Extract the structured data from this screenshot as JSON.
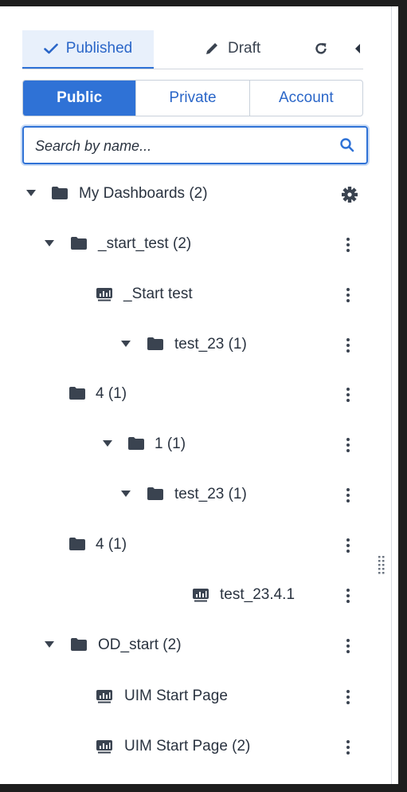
{
  "tabs": {
    "published_label": "Published",
    "draft_label": "Draft"
  },
  "segments": [
    "Public",
    "Private",
    "Account"
  ],
  "search": {
    "placeholder": "Search by name..."
  },
  "tree": {
    "root_label": "My Dashboards (2)",
    "items": [
      {
        "label": "_start_test (2)"
      },
      {
        "label": "_Start test"
      },
      {
        "label": "test_23 (1)"
      },
      {
        "label": "4 (1)"
      },
      {
        "label": "1 (1)"
      },
      {
        "label": "test_23 (1)"
      },
      {
        "label": "4 (1)"
      },
      {
        "label": "test_23.4.1"
      },
      {
        "label": "OD_start (2)"
      },
      {
        "label": "UIM Start Page"
      },
      {
        "label": "UIM Start Page (2)"
      }
    ]
  },
  "colors": {
    "accent": "#2f72d6",
    "text": "#2a3340",
    "icon": "#3a4350"
  }
}
